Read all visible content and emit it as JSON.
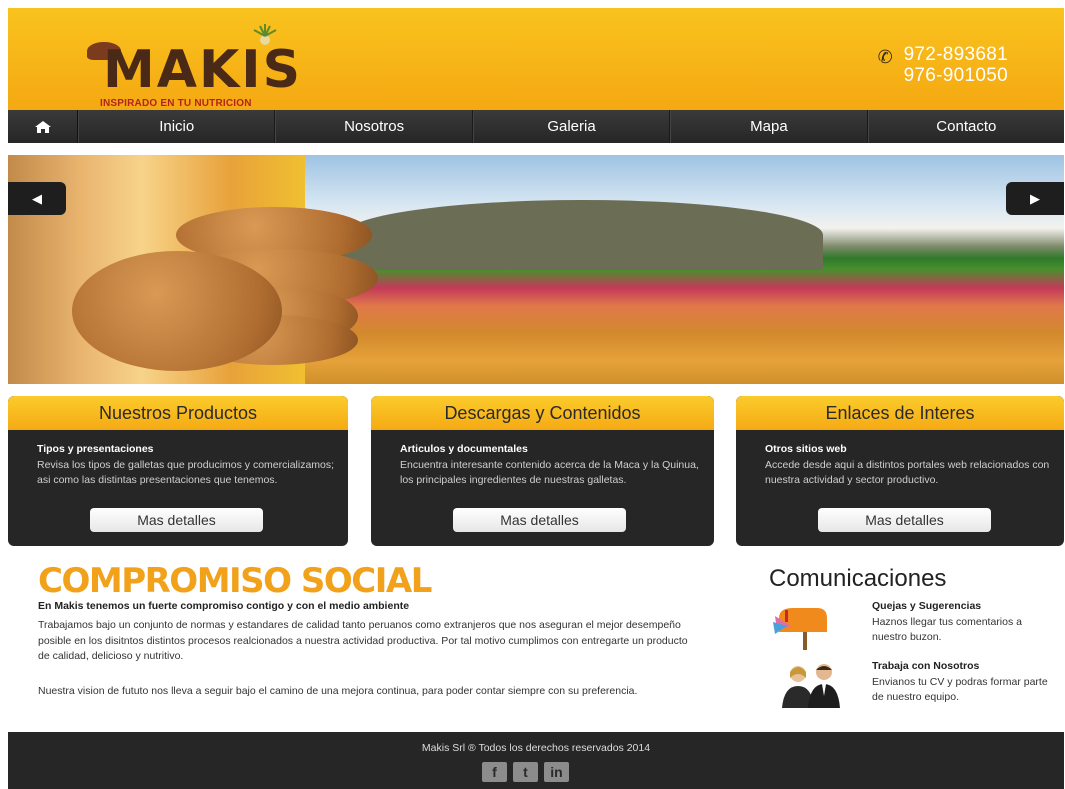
{
  "header": {
    "logo_text": "MAKIS",
    "logo_tagline": "INSPIRADO EN TU NUTRICION",
    "phone_icon": "phone-icon",
    "phones": [
      "972-893681",
      "976-901050"
    ]
  },
  "nav": {
    "home_icon": "home-icon",
    "items": [
      "Inicio",
      "Nosotros",
      "Galeria",
      "Mapa",
      "Contacto"
    ]
  },
  "slider": {
    "prev_icon": "arrow-left-icon",
    "next_icon": "arrow-right-icon",
    "prev_glyph": "◀",
    "next_glyph": "▶"
  },
  "boxes": [
    {
      "heading": "Nuestros Productos",
      "subtitle": "Tipos y presentaciones",
      "text": "Revisa los tipos de galletas que producimos y comercializamos; asi como las distintas presentaciones que tenemos.",
      "button": "Mas detalles"
    },
    {
      "heading": "Descargas y Contenidos",
      "subtitle": "Articulos y documentales",
      "text": "Encuentra interesante contenido acerca de la Maca y la Quinua, los principales ingredientes de nuestras galletas.",
      "button": "Mas detalles"
    },
    {
      "heading": "Enlaces de Interes",
      "subtitle": "Otros sitios web",
      "text": "Accede desde aqui a distintos portales web relacionados con nuestra actividad y sector productivo.",
      "button": "Mas detalles"
    }
  ],
  "compromiso": {
    "title": "COMPROMISO SOCIAL",
    "subtitle": "En Makis tenemos un fuerte compromiso contigo y con el medio ambiente",
    "paragraph1": "Trabajamos bajo un conjunto de normas y estandares de calidad tanto peruanos como extranjeros que nos aseguran el mejor desempeño posible en los disitntos distintos procesos realcionados a nuestra actividad productiva. Por tal motivo cumplimos con entregarte un producto de calidad, delicioso y nutritivo.",
    "paragraph2": "Nuestra vision de fututo nos lleva a seguir bajo el camino de una mejora continua, para poder contar siempre con su preferencia."
  },
  "comunicaciones": {
    "title": "Comunicaciones",
    "items": [
      {
        "title": "Quejas y Sugerencias",
        "text": "Haznos llegar tus comentarios a nuestro buzon."
      },
      {
        "title": "Trabaja con Nosotros",
        "text": "Envianos tu CV y podras formar parte de nuestro equipo."
      }
    ]
  },
  "footer": {
    "copyright": "Makis Srl ® Todos los derechos reservados 2014",
    "socials": [
      {
        "icon": "facebook-icon",
        "glyph": "f"
      },
      {
        "icon": "twitter-icon",
        "glyph": "t"
      },
      {
        "icon": "linkedin-icon",
        "glyph": "in"
      }
    ]
  },
  "colors": {
    "brand_orange": "#f5a812",
    "dark_bar": "#262626",
    "title_orange": "#f1a21a"
  }
}
